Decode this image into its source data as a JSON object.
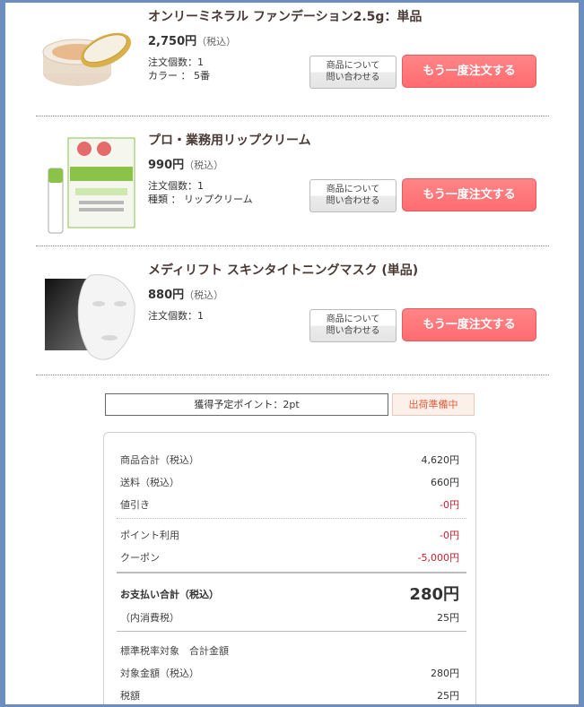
{
  "items": [
    {
      "name": "オンリーミネラル ファンデーション2.5g：単品",
      "price": "2,750円",
      "tax_note": "（税込）",
      "qty": "注文個数：1",
      "option": "カラー ： 5番",
      "inquiry_line1": "商品について",
      "inquiry_line2": "問い合わせる",
      "reorder": "もう一度注文する"
    },
    {
      "name": "プロ・業務用リップクリーム",
      "price": "990円",
      "tax_note": "（税込）",
      "qty": "注文個数：1",
      "option": "種類 ： リップクリーム",
      "inquiry_line1": "商品について",
      "inquiry_line2": "問い合わせる",
      "reorder": "もう一度注文する"
    },
    {
      "name": "メディリフト スキンタイトニングマスク (単品)",
      "price": "880円",
      "tax_note": "（税込）",
      "qty": "注文個数：1",
      "inquiry_line1": "商品について",
      "inquiry_line2": "問い合わせる",
      "reorder": "もう一度注文する"
    }
  ],
  "points": "獲得予定ポイント：2pt",
  "status": "出荷準備中",
  "summary": {
    "subtotal_label": "商品合計（税込）",
    "subtotal": "4,620円",
    "shipping_label": "送料（税込）",
    "shipping": "660円",
    "discount_label": "値引き",
    "discount": "-0円",
    "points_label": "ポイント利用",
    "points_used": "-0円",
    "coupon_label": "クーポン",
    "coupon": "-5,000円",
    "total_label": "お支払い合計（税込）",
    "total": "280円",
    "inner_tax_label": "（内消費税）",
    "inner_tax": "25円",
    "tax_header": "標準税率対象　合計金額",
    "taxable_label": "対象金額（税込）",
    "taxable": "280円",
    "tax_label": "税額",
    "tax": "25円"
  },
  "colors": {
    "reorder_button": "#ff6c70",
    "negative_value": "#cc1f2d",
    "status_text": "#e55a3c",
    "frame": "#6c8ebf"
  }
}
